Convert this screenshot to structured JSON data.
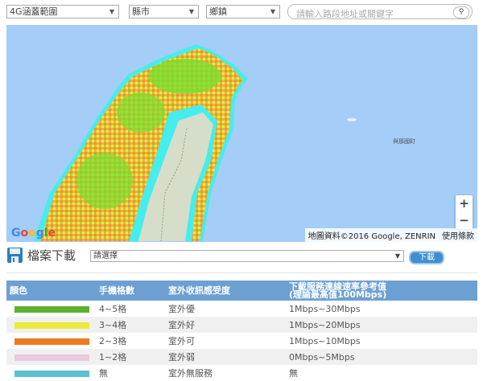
{
  "filters": {
    "coverage": "4G涵蓋範圍",
    "county": "縣市",
    "township": "鄉鎮",
    "search_placeholder": "請輸入路段地址或關鍵字",
    "search_icon": "magnifier-icon"
  },
  "map": {
    "island_label": "與那國町",
    "zoom_in": "+",
    "zoom_out": "−",
    "logo": "Google",
    "attribution": "地圖資料©2016 Google, ZENRIN",
    "terms": "使用條款",
    "colors": {
      "ocean": "#a4cdf7",
      "excellent": "#66dd22",
      "good": "#eeee33",
      "fair": "#ff8833",
      "none": "#44eeee",
      "mountain": "#d6ddc8"
    }
  },
  "download": {
    "icon": "floppy-disk-icon",
    "title": "檔案下載",
    "select_value": "請選擇",
    "button": "下載"
  },
  "legend": {
    "headers": [
      "顏色",
      "手機格數",
      "室外收訊感受度",
      "下載服務連線速率參考值",
      "(理論最高值100Mbps)"
    ],
    "rows": [
      {
        "color": "#5cb030",
        "bars": "4~5格",
        "signal": "室外優",
        "speed": "1Mbps~30Mbps"
      },
      {
        "color": "#eeea3a",
        "bars": "3~4格",
        "signal": "室外好",
        "speed": "1Mbps~20Mbps"
      },
      {
        "color": "#f07a22",
        "bars": "2~3格",
        "signal": "室外可",
        "speed": "1Mbps~10Mbps"
      },
      {
        "color": "#ecc9dc",
        "bars": "1~2格",
        "signal": "室外弱",
        "speed": "0Mbps~5Mbps"
      },
      {
        "color": "#5ebfd2",
        "bars": "無",
        "signal": "室外無服務",
        "speed": "無"
      }
    ]
  }
}
